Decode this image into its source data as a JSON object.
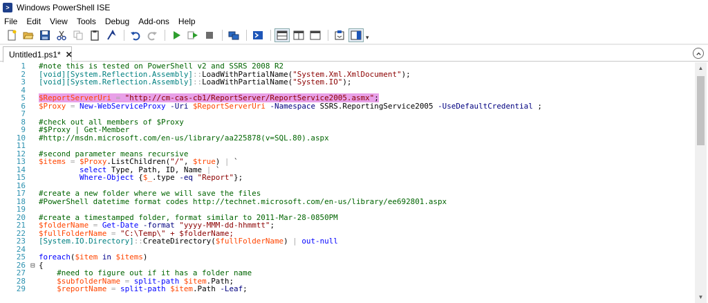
{
  "window": {
    "title": "Windows PowerShell ISE"
  },
  "menu": [
    "File",
    "Edit",
    "View",
    "Tools",
    "Debug",
    "Add-ons",
    "Help"
  ],
  "toolbar": {
    "icons": [
      "new-file-icon",
      "open-file-icon",
      "save-icon",
      "cut-icon",
      "copy-icon",
      "paste-icon",
      "clear-console-icon",
      "undo-icon",
      "redo-icon",
      "run-script-icon",
      "run-selection-icon",
      "stop-icon",
      "new-remote-tab-icon",
      "start-powershell-icon",
      "show-script-pane-top-icon",
      "show-script-pane-right-icon",
      "show-script-pane-max-icon",
      "show-command-addon-icon",
      "show-command-window-icon"
    ]
  },
  "tab": {
    "label": "Untitled1.ps1*",
    "close_symbol": "✕"
  },
  "editor": {
    "line_numbers": [
      "1",
      "2",
      "3",
      "4",
      "5",
      "6",
      "7",
      "8",
      "9",
      "10",
      "11",
      "12",
      "13",
      "14",
      "15",
      "16",
      "17",
      "18",
      "19",
      "20",
      "21",
      "22",
      "23",
      "24",
      "25",
      "26",
      "27",
      "28",
      "29"
    ],
    "lines": [
      "#note this is tested on PowerShell v2 and SSRS 2008 R2",
      "[void][System.Reflection.Assembly]::LoadWithPartialName(\"System.Xml.XmlDocument\");",
      "[void][System.Reflection.Assembly]::LoadWithPartialName(\"System.IO\");",
      "",
      "$ReportServerUri = \"http://cm-cas-cb1/ReportServer/ReportService2005.asmx\";",
      "$Proxy = New-WebServiceProxy -Uri $ReportServerUri -Namespace SSRS.ReportingService2005 -UseDefaultCredential ;",
      "",
      "#check out all members of $Proxy",
      "#$Proxy | Get-Member",
      "#http://msdn.microsoft.com/en-us/library/aa225878(v=SQL.80).aspx",
      "",
      "#second parameter means recursive",
      "$items = $Proxy.ListChildren(\"/\", $true) | `",
      "         select Type, Path, ID, Name | `",
      "         Where-Object {$_.type -eq \"Report\"};",
      "",
      "#create a new folder where we will save the files",
      "#PowerShell datetime format codes http://technet.microsoft.com/en-us/library/ee692801.aspx",
      "",
      "#create a timestamped folder, format similar to 2011-Mar-28-0850PM",
      "$folderName = Get-Date -format \"yyyy-MMM-dd-hhmmtt\";",
      "$fullFolderName = \"C:\\Temp\\\" + $folderName;",
      "[System.IO.Directory]::CreateDirectory($fullFolderName) | out-null",
      "",
      "foreach($item in $items)",
      "{",
      "    #need to figure out if it has a folder name",
      "    $subfolderName = split-path $item.Path;",
      "    $reportName = split-path $item.Path -Leaf;"
    ]
  }
}
